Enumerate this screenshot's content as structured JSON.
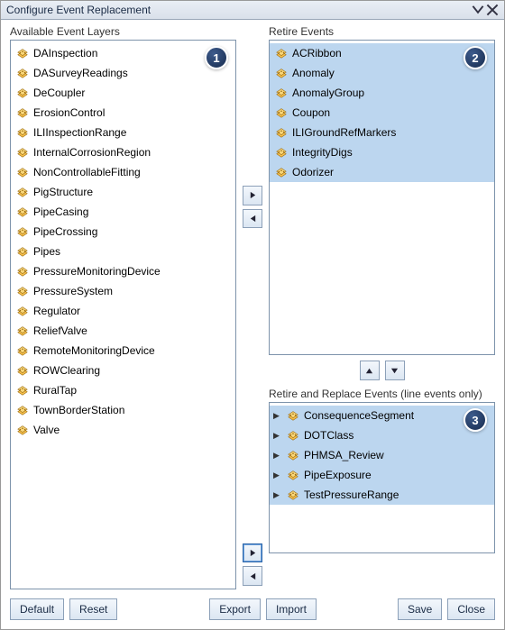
{
  "window": {
    "title": "Configure Event Replacement"
  },
  "left": {
    "label": "Available Event Layers",
    "items": [
      "DAInspection",
      "DASurveyReadings",
      "DeCoupler",
      "ErosionControl",
      "ILIInspectionRange",
      "InternalCorrosionRegion",
      "NonControllableFitting",
      "PigStructure",
      "PipeCasing",
      "PipeCrossing",
      "Pipes",
      "PressureMonitoringDevice",
      "PressureSystem",
      "Regulator",
      "ReliefValve",
      "RemoteMonitoringDevice",
      "ROWClearing",
      "RuralTap",
      "TownBorderStation",
      "Valve"
    ],
    "badge": "1"
  },
  "retire": {
    "label": "Retire Events",
    "items": [
      "ACRibbon",
      "Anomaly",
      "AnomalyGroup",
      "Coupon",
      "ILIGroundRefMarkers",
      "IntegrityDigs",
      "Odorizer"
    ],
    "badge": "2"
  },
  "replace": {
    "label": "Retire and Replace Events (line events only)",
    "items": [
      "ConsequenceSegment",
      "DOTClass",
      "PHMSA_Review",
      "PipeExposure",
      "TestPressureRange"
    ],
    "badge": "3"
  },
  "buttons": {
    "default": "Default",
    "reset": "Reset",
    "export": "Export",
    "import": "Import",
    "save": "Save",
    "close": "Close"
  }
}
